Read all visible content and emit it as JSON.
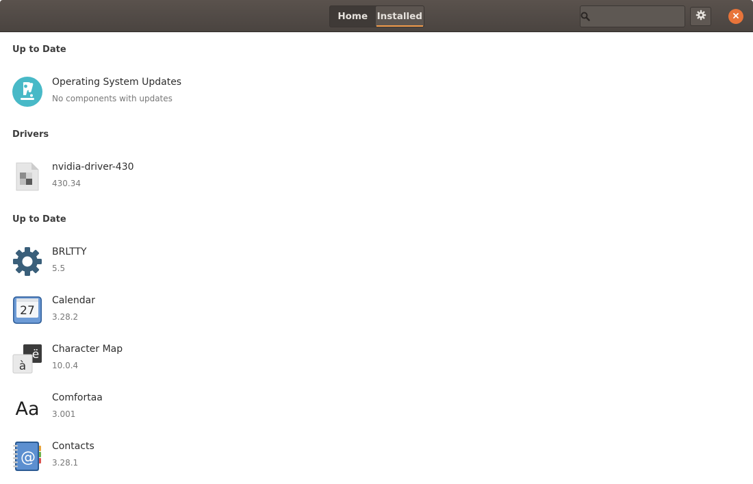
{
  "header": {
    "tabs": [
      {
        "label": "Home",
        "active": false
      },
      {
        "label": "Installed",
        "active": true
      }
    ],
    "search": {
      "placeholder": "",
      "value": ""
    },
    "icons": {
      "search": "search-icon",
      "settings": "gear-icon",
      "close": "close-icon"
    },
    "colors": {
      "accent": "#f39c4b",
      "close": "#e8743a",
      "headerbar": "#514a46"
    }
  },
  "sections": [
    {
      "title": "Up to Date",
      "items": [
        {
          "name": "Operating System Updates",
          "subtitle": "No components with updates",
          "icon": "pop-os-logo-icon"
        }
      ]
    },
    {
      "title": "Drivers",
      "items": [
        {
          "name": "nvidia-driver-430",
          "subtitle": "430.34",
          "icon": "generic-package-icon"
        }
      ]
    },
    {
      "title": "Up to Date",
      "items": [
        {
          "name": "BRLTTY",
          "subtitle": "5.5",
          "icon": "gear-icon"
        },
        {
          "name": "Calendar",
          "subtitle": "3.28.2",
          "icon": "calendar-icon",
          "icon_text": "27"
        },
        {
          "name": "Character Map",
          "subtitle": "10.0.4",
          "icon": "character-map-icon",
          "icon_text": [
            "ë",
            "à"
          ]
        },
        {
          "name": "Comfortaa",
          "subtitle": "3.001",
          "icon": "font-icon",
          "icon_text": "Aa"
        },
        {
          "name": "Contacts",
          "subtitle": "3.28.1",
          "icon": "address-book-icon",
          "icon_text": "@"
        }
      ]
    }
  ]
}
